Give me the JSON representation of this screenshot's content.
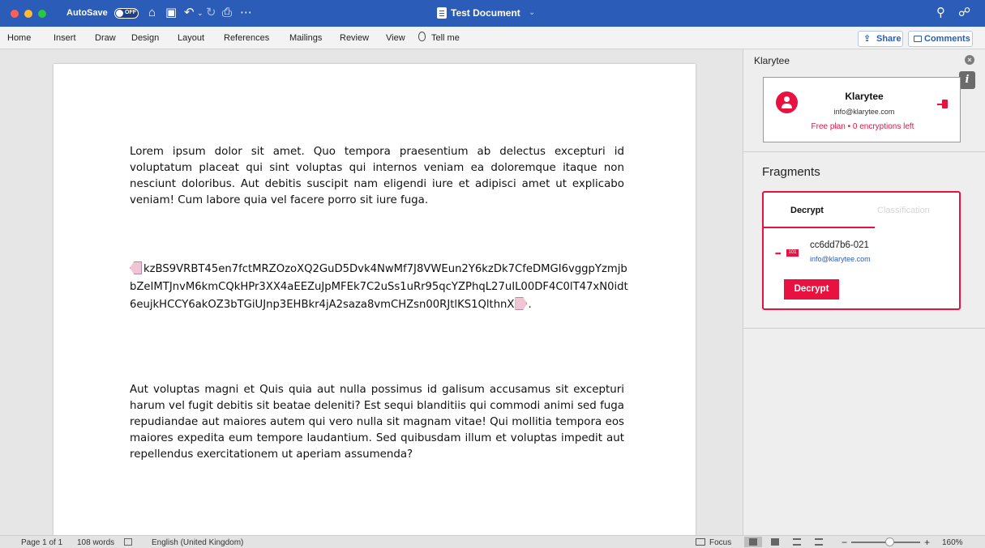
{
  "titlebar": {
    "autosave_label": "AutoSave",
    "autosave_state": "OFF",
    "document_title": "Test Document",
    "icons": [
      "home-icon",
      "save-icon",
      "undo-icon",
      "redo-icon",
      "print-icon",
      "more-icon",
      "search-icon",
      "share-people-icon"
    ]
  },
  "ribbon": {
    "tabs": [
      "Home",
      "Insert",
      "Draw",
      "Design",
      "Layout",
      "References",
      "Mailings",
      "Review",
      "View"
    ],
    "tell_me": "Tell me",
    "share_label": "Share",
    "comments_label": "Comments"
  },
  "document": {
    "paragraph1": "Lorem ipsum dolor sit amet. Quo tempora praesentium ab delectus excepturi id voluptatum placeat qui sint voluptas qui internos veniam ea doloremque itaque non nesciunt doloribus. Aut debitis suscipit nam eligendi iure et adipisci amet ut explicabo veniam! Cum labore quia vel facere porro sit iure fuga.",
    "cipher_text": "kzBS9VRBT45en7fctMRZOzoXQ2GuD5Dvk4NwMf7J8VWEun2Y6kzDk7CfeDMGI6vggpYzmjbbZeIMTJnvM6kmCQkHPr3XX4aEEZuJpMFEk7C2uSs1uRr95qcYZPhqL27uIL00DF4C0lT47xN0idt6eujkHCCY6akOZ3bTGiUJnp3EHBkr4jA2saza8vmCHZsn00RJtlKS1QlthnX",
    "cipher_suffix": ".",
    "paragraph3": "Aut voluptas magni et Quis quia aut nulla possimus id galisum accusamus sit excepturi harum vel fugit debitis sit beatae deleniti? Est sequi blanditiis qui commodi animi sed fuga repudiandae aut maiores autem qui vero nulla sit magnam vitae! Qui mollitia tempora eos maiores expedita eum tempore laudantium. Sed quibusdam illum et voluptas impedit aut repellendus exercitationem ut aperiam assumenda?"
  },
  "pane": {
    "title": "Klarytee",
    "info_label": "i",
    "user": {
      "name": "Klarytee",
      "email": "info@klarytee.com",
      "plan": "Free plan • 0 encryptions left"
    },
    "fragments": {
      "heading": "Fragments",
      "tab_decrypt": "Decrypt",
      "tab_classification": "Classification",
      "icon_binary": "101",
      "item_id": "cc6dd7b6-021",
      "item_email": "info@klarytee.com",
      "decrypt_button": "Decrypt"
    },
    "accent_color": "#e8113f"
  },
  "statusbar": {
    "page": "Page 1 of 1",
    "words": "108 words",
    "language": "English (United Kingdom)",
    "focus": "Focus",
    "zoom_minus": "−",
    "zoom_plus": "+",
    "zoom": "160%",
    "zoom_level_percent": 160
  }
}
